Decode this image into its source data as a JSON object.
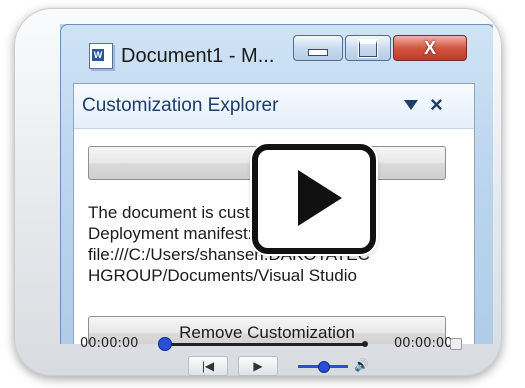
{
  "window": {
    "title": "Document1 - M...",
    "app_icon": "word-document-icon",
    "app_icon_letter": "W",
    "minimize_icon": "minimize-icon",
    "maximize_icon": "maximize-icon",
    "close_glyph": "X"
  },
  "pane": {
    "title": "Customization Explorer",
    "dropdown_icon": "chevron-down-icon",
    "close_glyph": "×",
    "top_button_label": "...",
    "status_lines": [
      "The document is customized.",
      "Deployment manifest:",
      "file:///C:/Users/shansen.DAKOTATEC",
      "HGROUP/Documents/Visual Studio"
    ],
    "remove_button_label": "Remove Customization"
  },
  "player": {
    "play_overlay_icon": "play-icon",
    "current_time": "00:00:00",
    "total_time": "00:00:00",
    "progress": 0.0,
    "volume": 0.5,
    "prev_glyph": "|◀",
    "play_glyph": "▶",
    "volume_glyph": "🔊"
  },
  "colors": {
    "accent_blue": "#2a4fd6",
    "close_red": "#c0392b"
  }
}
